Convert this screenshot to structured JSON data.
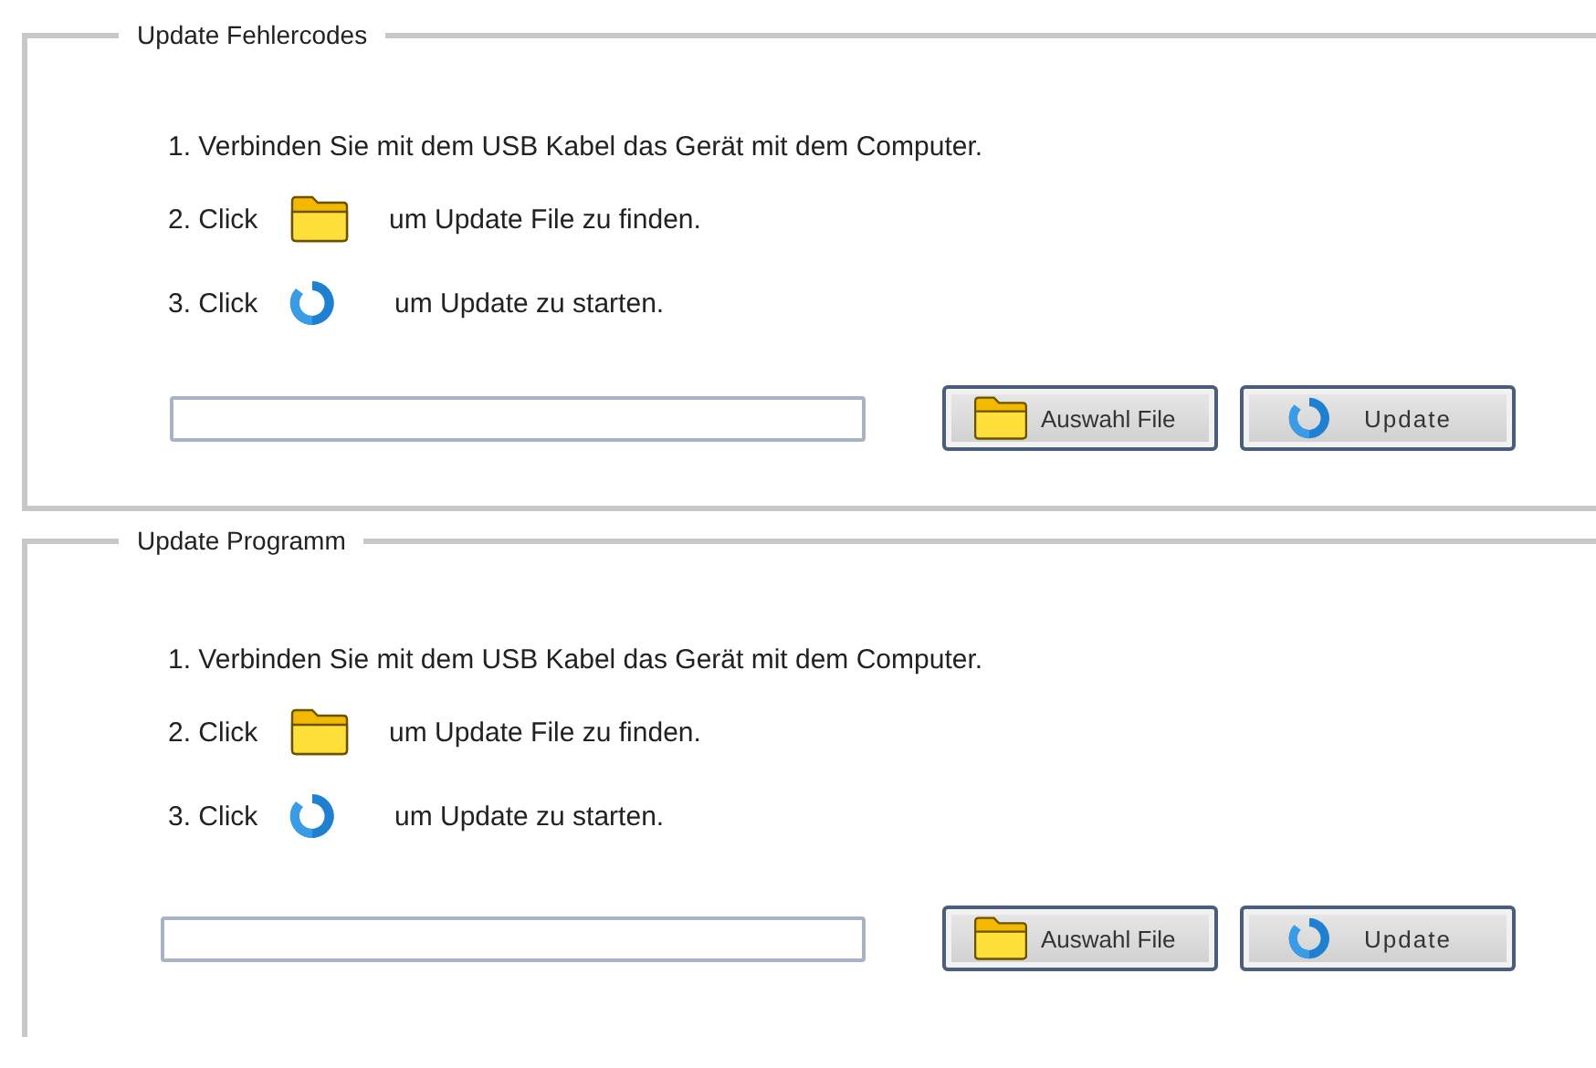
{
  "panels": [
    {
      "title": "Update Fehlercodes",
      "steps": [
        {
          "kind": "plain",
          "text": "1. Verbinden Sie mit dem USB Kabel das Gerät mit dem Computer."
        },
        {
          "kind": "browse",
          "lead": "2. Click",
          "text": "um Update File zu finden."
        },
        {
          "kind": "update",
          "lead": "3. Click",
          "text": "um Update zu starten."
        }
      ],
      "buttons": [
        {
          "kind": "browse",
          "label": "Auswahl File"
        },
        {
          "kind": "update",
          "label": "Update"
        }
      ]
    },
    {
      "title": "Update Programm",
      "steps": [
        {
          "kind": "plain",
          "text": "1. Verbinden Sie mit dem USB Kabel das Gerät mit dem Computer."
        },
        {
          "kind": "browse",
          "lead": "2. Click",
          "text": "um Update File zu finden."
        },
        {
          "kind": "update",
          "lead": "3. Click",
          "text": "um Update zu starten."
        }
      ],
      "buttons": [
        {
          "kind": "browse",
          "label": "Auswahl File"
        },
        {
          "kind": "update",
          "label": "Update"
        }
      ]
    }
  ]
}
